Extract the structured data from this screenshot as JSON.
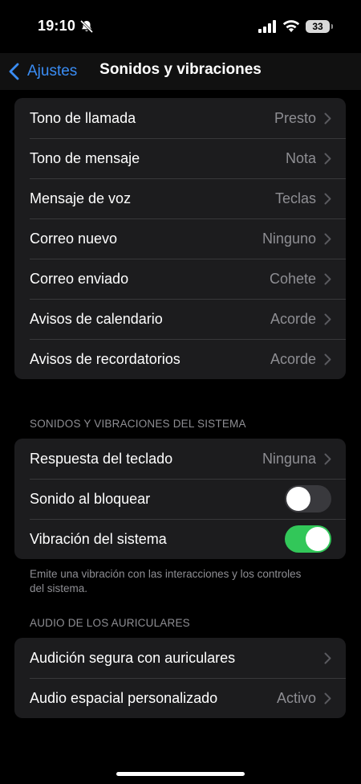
{
  "status_bar": {
    "time": "19:10",
    "battery": "33"
  },
  "nav": {
    "back_label": "Ajustes",
    "title": "Sonidos y vibraciones"
  },
  "sounds": [
    {
      "label": "Tono de llamada",
      "value": "Presto"
    },
    {
      "label": "Tono de mensaje",
      "value": "Nota"
    },
    {
      "label": "Mensaje de voz",
      "value": "Teclas"
    },
    {
      "label": "Correo nuevo",
      "value": "Ninguno"
    },
    {
      "label": "Correo enviado",
      "value": "Cohete"
    },
    {
      "label": "Avisos de calendario",
      "value": "Acorde"
    },
    {
      "label": "Avisos de recordatorios",
      "value": "Acorde"
    }
  ],
  "system": {
    "header": "SONIDOS Y VIBRACIONES DEL SISTEMA",
    "keyboard_label": "Respuesta del teclado",
    "keyboard_value": "Ninguna",
    "lock_sound_label": "Sonido al bloquear",
    "lock_sound_on": false,
    "vibration_label": "Vibración del sistema",
    "vibration_on": true,
    "footer": "Emite una vibración con las interacciones y los controles del sistema."
  },
  "headphones": {
    "header": "AUDIO DE LOS AURICULARES",
    "safe_label": "Audición segura con auriculares",
    "spatial_label": "Audio espacial personalizado",
    "spatial_value": "Activo"
  },
  "colors": {
    "accent": "#3a8df5",
    "toggle_on": "#32c759",
    "toggle_off": "#39393d"
  }
}
